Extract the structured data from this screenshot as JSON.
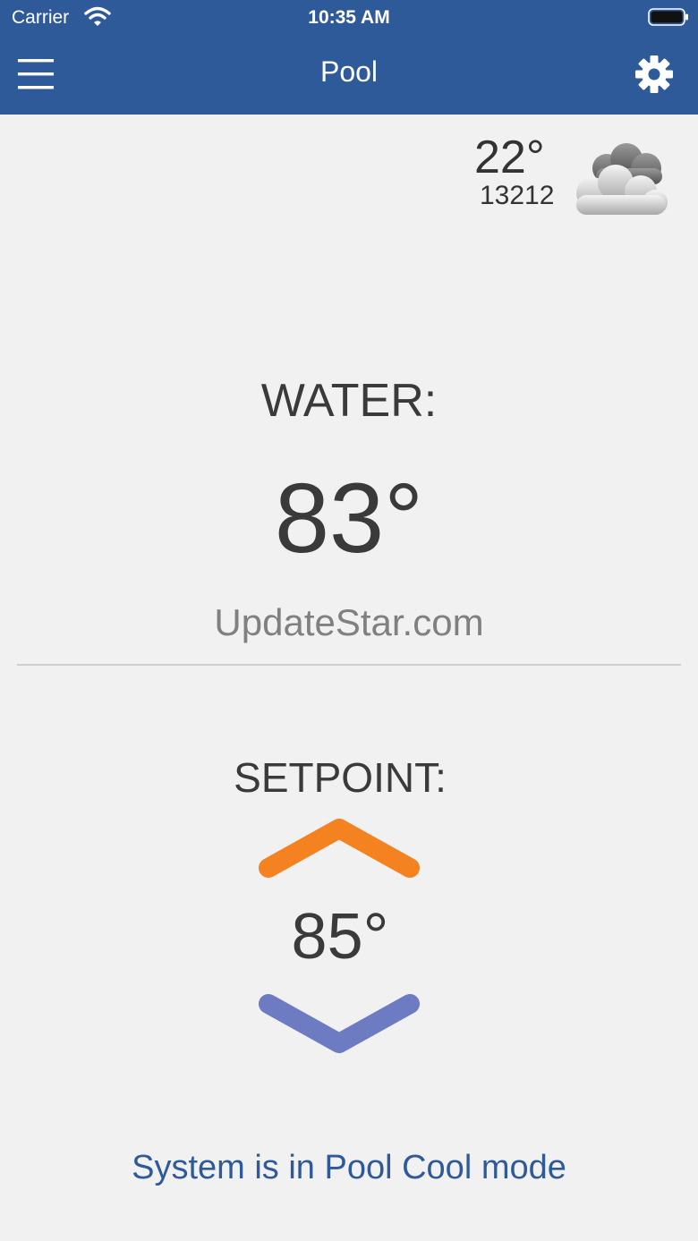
{
  "status_bar": {
    "carrier": "Carrier",
    "time": "10:35 AM"
  },
  "nav": {
    "title": "Pool",
    "left_icon": "menu-icon",
    "right_icon": "gear-icon"
  },
  "weather": {
    "temperature": "22°",
    "zip": "13212",
    "icon": "cloud-icon"
  },
  "water": {
    "label": "WATER:",
    "temperature": "83°",
    "brand": "UpdateStar.com"
  },
  "setpoint": {
    "label": "SETPOINT:",
    "temperature": "85°",
    "up_color": "#f58220",
    "down_color": "#6c7bc2"
  },
  "mode": {
    "status": "System is in Pool Cool mode"
  },
  "colors": {
    "header": "#2f5a9a",
    "background": "#f1f1f1",
    "accent": "#2f5a9a"
  }
}
